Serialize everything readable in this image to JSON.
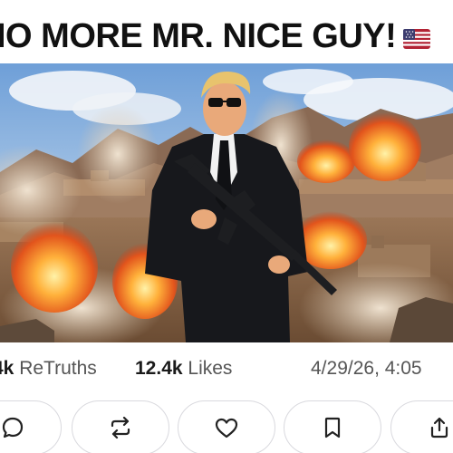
{
  "post": {
    "headline": "IO MORE MR. NICE GUY!",
    "flag_icon": "us-flag-icon",
    "image_alt": "man-in-suit-with-rifle-explosions"
  },
  "stats": {
    "retruths_count": "4k",
    "retruths_label": "ReTruths",
    "likes_count": "12.4k",
    "likes_label": "Likes",
    "timestamp": "4/29/26, 4:05"
  },
  "actions": [
    {
      "name": "reply",
      "icon": "speech-bubble-icon"
    },
    {
      "name": "retruth",
      "icon": "repost-arrows-icon"
    },
    {
      "name": "like",
      "icon": "heart-icon"
    },
    {
      "name": "bookmark",
      "icon": "bookmark-icon"
    },
    {
      "name": "share",
      "icon": "share-upload-icon"
    }
  ],
  "colors": {
    "text": "#111111",
    "muted": "#555555",
    "border": "#d9d9de"
  }
}
